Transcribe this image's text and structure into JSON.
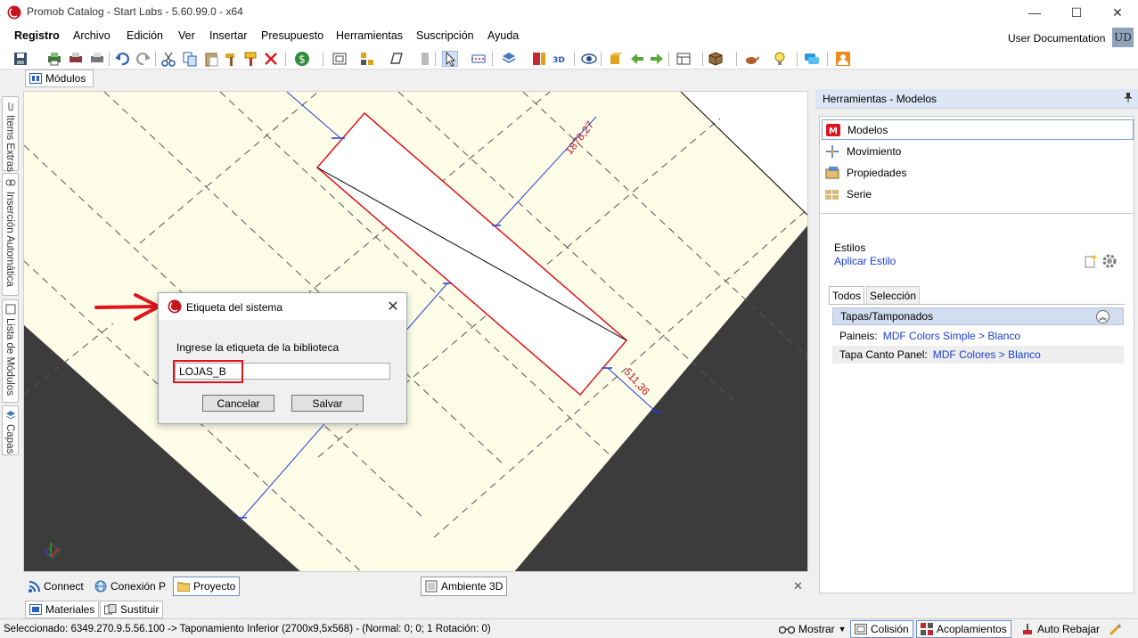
{
  "window": {
    "title": "Promob Catalog - Start Labs - 5.60.99.0 - x64",
    "minimize": "—",
    "maximize": "☐",
    "close": "✕"
  },
  "menu": {
    "items": [
      "Registro",
      "Archivo",
      "Edición",
      "Ver",
      "Insertar",
      "Presupuesto",
      "Herramientas",
      "Suscripción",
      "Ayuda"
    ],
    "user": "User Documentation",
    "avatar": "UD"
  },
  "toolbar": {
    "icons": [
      "save-icon",
      "print-icon",
      "undo-icon",
      "redo-icon",
      "cut-icon",
      "copy-icon",
      "paste-icon",
      "delete-icon",
      "budget-icon",
      "select-icon",
      "layers-icon",
      "3d-icon",
      "view-icon",
      "cube-icon",
      "help-icon",
      "chat-icon",
      "user-icon"
    ]
  },
  "doc_tab": {
    "label": "Módulos"
  },
  "left_tabs": [
    "Items Extras",
    "Inserción Automática",
    "Lista de Módulos",
    "Capas"
  ],
  "canvas": {
    "dim_1": "1878,27",
    "dim_2": "511,36"
  },
  "dialog": {
    "title": "Etiqueta del sistema",
    "close": "✕",
    "label": "Ingrese la etiqueta de la biblioteca",
    "input_value": "LOJAS_B",
    "cancel": "Cancelar",
    "save": "Salvar"
  },
  "right_panel": {
    "title": "Herramientas - Modelos",
    "pin": "📌",
    "items": [
      "Modelos",
      "Movimiento",
      "Propiedades",
      "Serie"
    ],
    "estilos_label": "Estilos",
    "aplicar_estilo": "Aplicar Estilo",
    "tabs": [
      "Todos",
      "Selección"
    ],
    "group": "Tapas/Tamponados",
    "props": [
      {
        "name": "Paineis:",
        "value": "MDF Colors Simple > Blanco"
      },
      {
        "name": "Tapa Canto Panel:",
        "value": "MDF Colores > Blanco"
      }
    ]
  },
  "bottom_tabs": {
    "items": [
      "Connect",
      "Conexión P",
      "Proyecto"
    ],
    "ambiente": "Ambiente 3D",
    "close": "✕"
  },
  "material_tabs": [
    "Materiales",
    "Sustituir"
  ],
  "status": {
    "text": "Seleccionado: 6349.270.9.5.56.100 -> Taponamiento Inferior (2700x9,5x568) - (Normal: 0; 0; 1 Rotación: 0)",
    "mostrar": "Mostrar",
    "colision": "Colisión",
    "acoplamientos": "Acoplamientos",
    "auto_rebajar": "Auto Rebajar"
  },
  "colors": {
    "accent_red": "#e0141e",
    "floor": "#fdfde8",
    "dark": "#3c3c3c",
    "link_blue": "#1a3fd0"
  }
}
